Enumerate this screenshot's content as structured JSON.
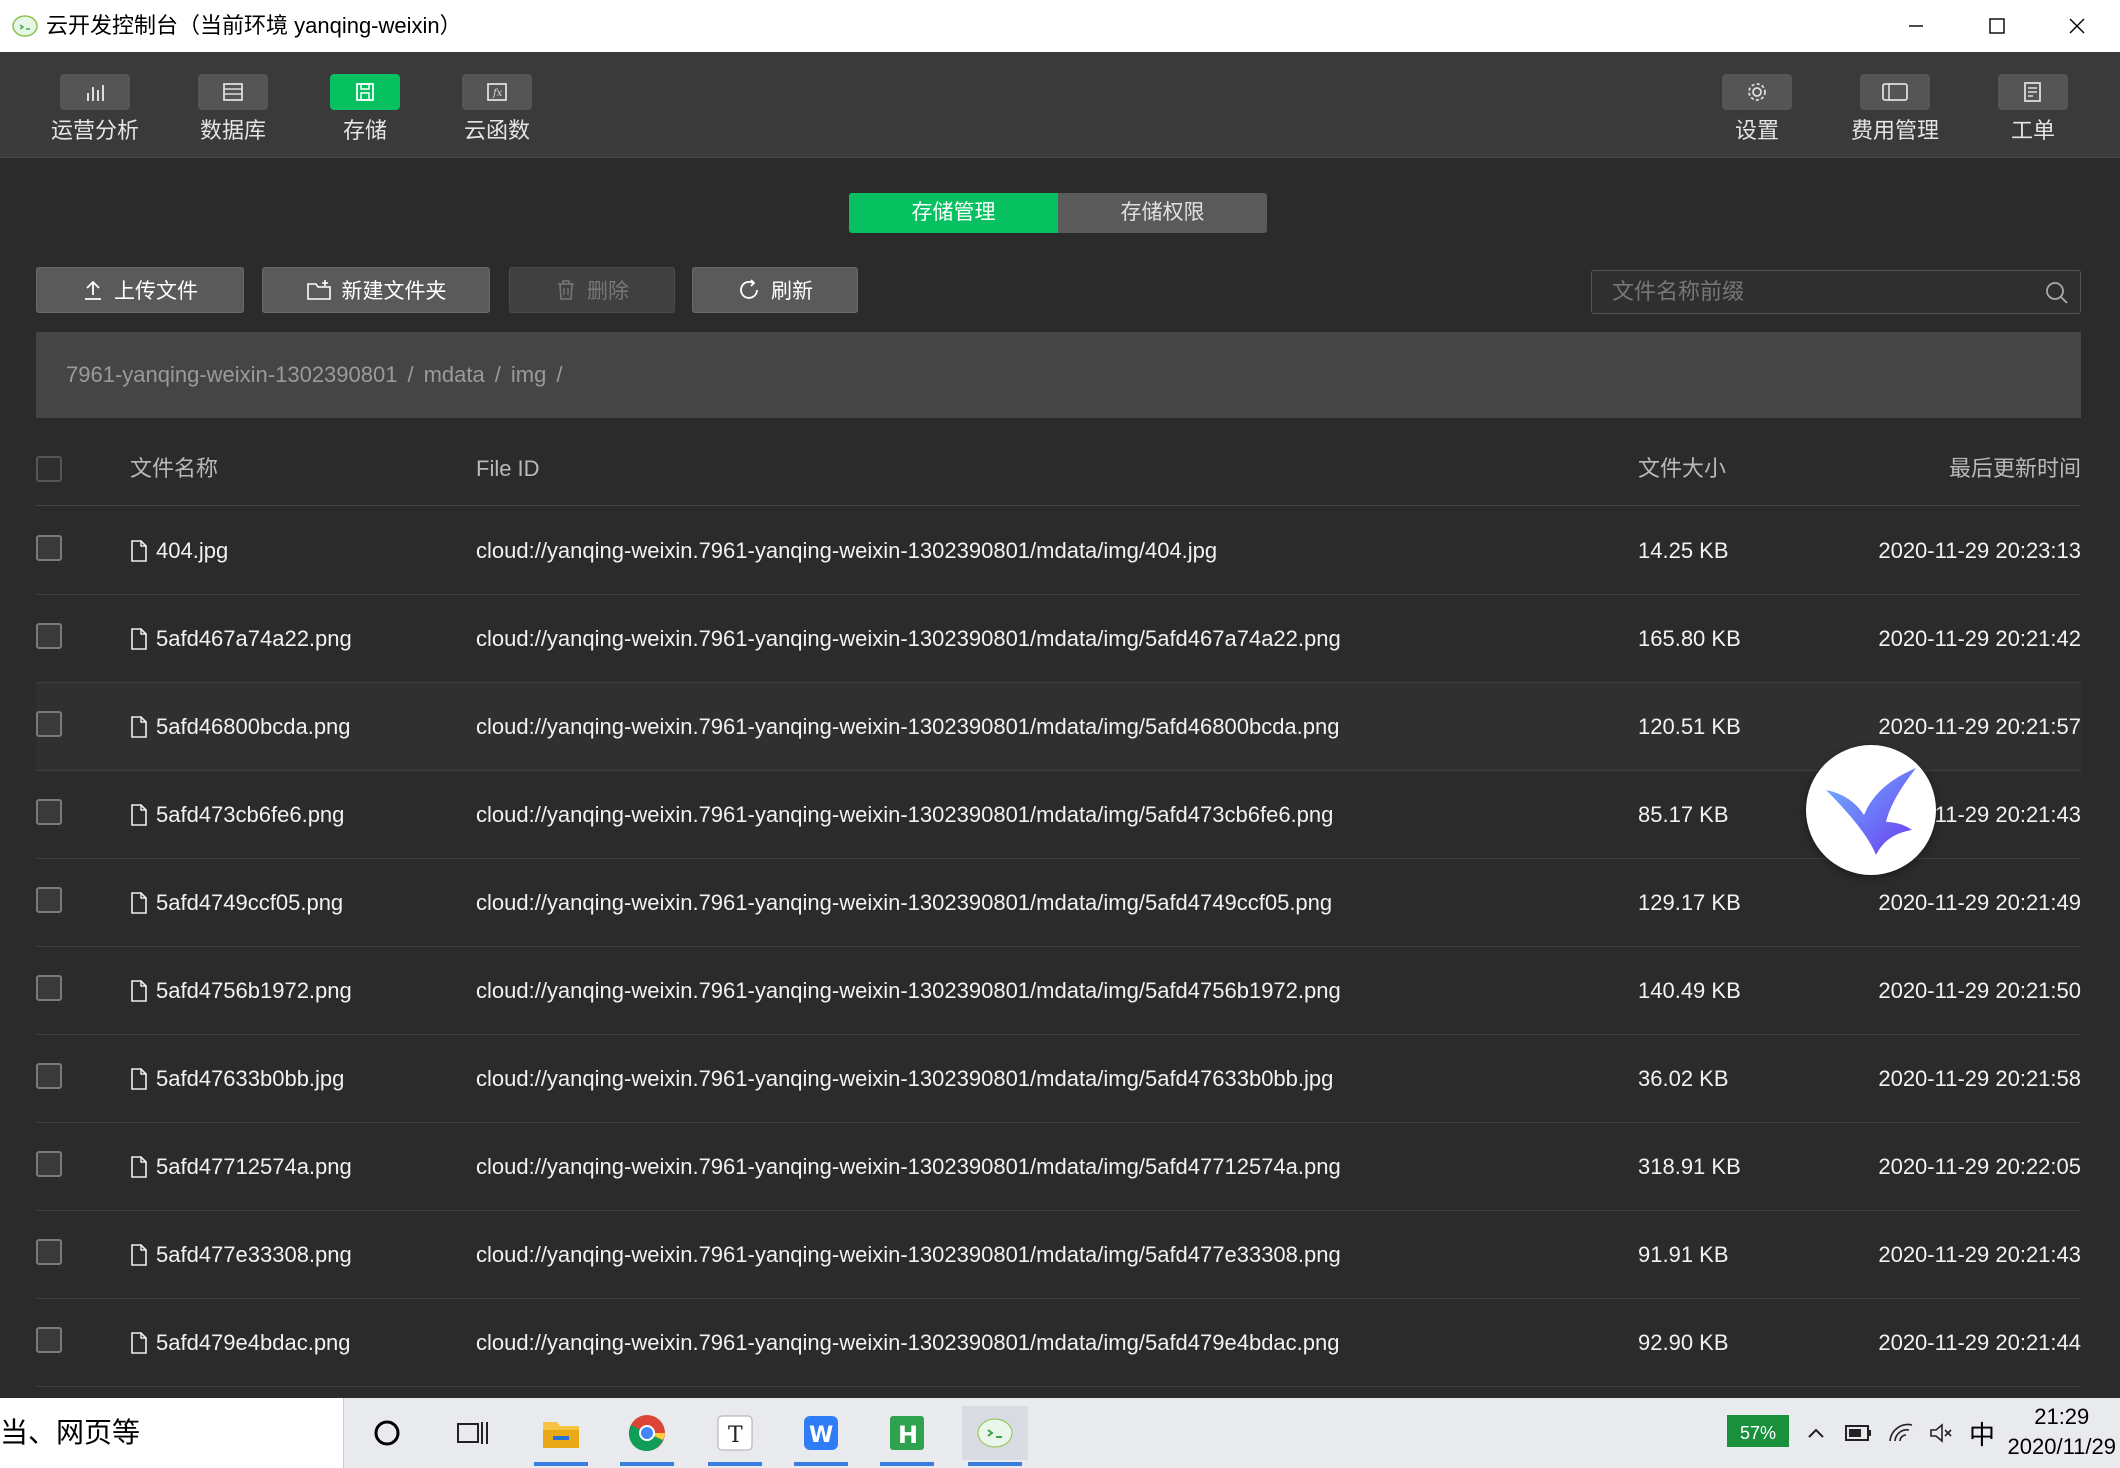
{
  "window": {
    "title": "云开发控制台（当前环境 yanqing-weixin）"
  },
  "nav": {
    "left": [
      {
        "label": "运营分析",
        "icon": "bar-chart-icon"
      },
      {
        "label": "数据库",
        "icon": "database-icon"
      },
      {
        "label": "存储",
        "icon": "storage-icon",
        "active": true
      },
      {
        "label": "云函数",
        "icon": "function-icon"
      }
    ],
    "right": [
      {
        "label": "设置",
        "icon": "gear-icon"
      },
      {
        "label": "费用管理",
        "icon": "billing-icon"
      },
      {
        "label": "工单",
        "icon": "ticket-icon"
      }
    ]
  },
  "tabs": {
    "storage_manage": "存储管理",
    "storage_permission": "存储权限"
  },
  "toolbar": {
    "upload": "上传文件",
    "new_folder": "新建文件夹",
    "delete": "删除",
    "refresh": "刷新"
  },
  "search": {
    "placeholder": "文件名称前缀"
  },
  "breadcrumb": {
    "root": "7961-yanqing-weixin-1302390801",
    "folder1": "mdata",
    "folder2": "img",
    "sep": "/"
  },
  "table": {
    "headers": {
      "name": "文件名称",
      "file_id": "File ID",
      "size": "文件大小",
      "updated": "最后更新时间"
    },
    "rows": [
      {
        "name": "404.jpg",
        "file_id": "cloud://yanqing-weixin.7961-yanqing-weixin-1302390801/mdata/img/404.jpg",
        "size": "14.25 KB",
        "updated": "2020-11-29 20:23:13"
      },
      {
        "name": "5afd467a74a22.png",
        "file_id": "cloud://yanqing-weixin.7961-yanqing-weixin-1302390801/mdata/img/5afd467a74a22.png",
        "size": "165.80 KB",
        "updated": "2020-11-29 20:21:42"
      },
      {
        "name": "5afd46800bcda.png",
        "file_id": "cloud://yanqing-weixin.7961-yanqing-weixin-1302390801/mdata/img/5afd46800bcda.png",
        "size": "120.51 KB",
        "updated": "2020-11-29 20:21:57"
      },
      {
        "name": "5afd473cb6fe6.png",
        "file_id": "cloud://yanqing-weixin.7961-yanqing-weixin-1302390801/mdata/img/5afd473cb6fe6.png",
        "size": "85.17 KB",
        "updated": "2020-11-29 20:21:43"
      },
      {
        "name": "5afd4749ccf05.png",
        "file_id": "cloud://yanqing-weixin.7961-yanqing-weixin-1302390801/mdata/img/5afd4749ccf05.png",
        "size": "129.17 KB",
        "updated": "2020-11-29 20:21:49"
      },
      {
        "name": "5afd4756b1972.png",
        "file_id": "cloud://yanqing-weixin.7961-yanqing-weixin-1302390801/mdata/img/5afd4756b1972.png",
        "size": "140.49 KB",
        "updated": "2020-11-29 20:21:50"
      },
      {
        "name": "5afd47633b0bb.jpg",
        "file_id": "cloud://yanqing-weixin.7961-yanqing-weixin-1302390801/mdata/img/5afd47633b0bb.jpg",
        "size": "36.02 KB",
        "updated": "2020-11-29 20:21:58"
      },
      {
        "name": "5afd47712574a.png",
        "file_id": "cloud://yanqing-weixin.7961-yanqing-weixin-1302390801/mdata/img/5afd47712574a.png",
        "size": "318.91 KB",
        "updated": "2020-11-29 20:22:05"
      },
      {
        "name": "5afd477e33308.png",
        "file_id": "cloud://yanqing-weixin.7961-yanqing-weixin-1302390801/mdata/img/5afd477e33308.png",
        "size": "91.91 KB",
        "updated": "2020-11-29 20:21:43"
      },
      {
        "name": "5afd479e4bdac.png",
        "file_id": "cloud://yanqing-weixin.7961-yanqing-weixin-1302390801/mdata/img/5afd479e4bdac.png",
        "size": "92.90 KB",
        "updated": "2020-11-29 20:21:44"
      }
    ]
  },
  "taskbar": {
    "search_text": "当、网页等",
    "battery": "57%",
    "ime": "中",
    "time": "21:29",
    "date": "2020/11/29"
  },
  "colors": {
    "accent": "#07c160",
    "background": "#2b2b2b",
    "nav": "#3a3a3a"
  }
}
